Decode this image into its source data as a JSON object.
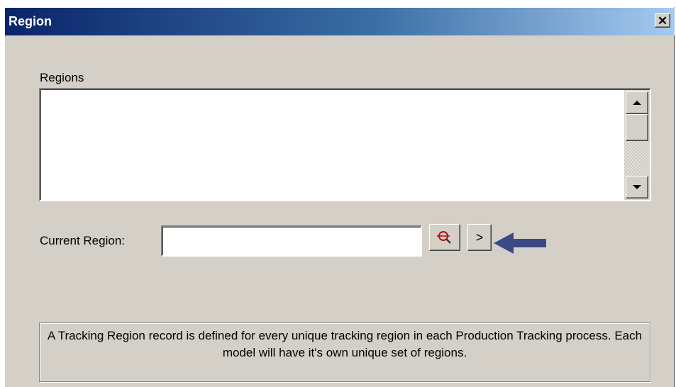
{
  "window": {
    "title": "Region",
    "close_label": "✕"
  },
  "regions": {
    "label": "Regions",
    "items": []
  },
  "current_region": {
    "label": "Current Region:",
    "value": "",
    "next_label": ">"
  },
  "info": {
    "text": "A Tracking Region record is defined for every unique tracking region in each Production Tracking process.  Each model will have it's own unique set of regions."
  },
  "colors": {
    "titlebar_start": "#0a246a",
    "titlebar_end": "#a6caf0",
    "dialog_bg": "#d4d0c8",
    "annotation_arrow": "#3b4a86"
  }
}
